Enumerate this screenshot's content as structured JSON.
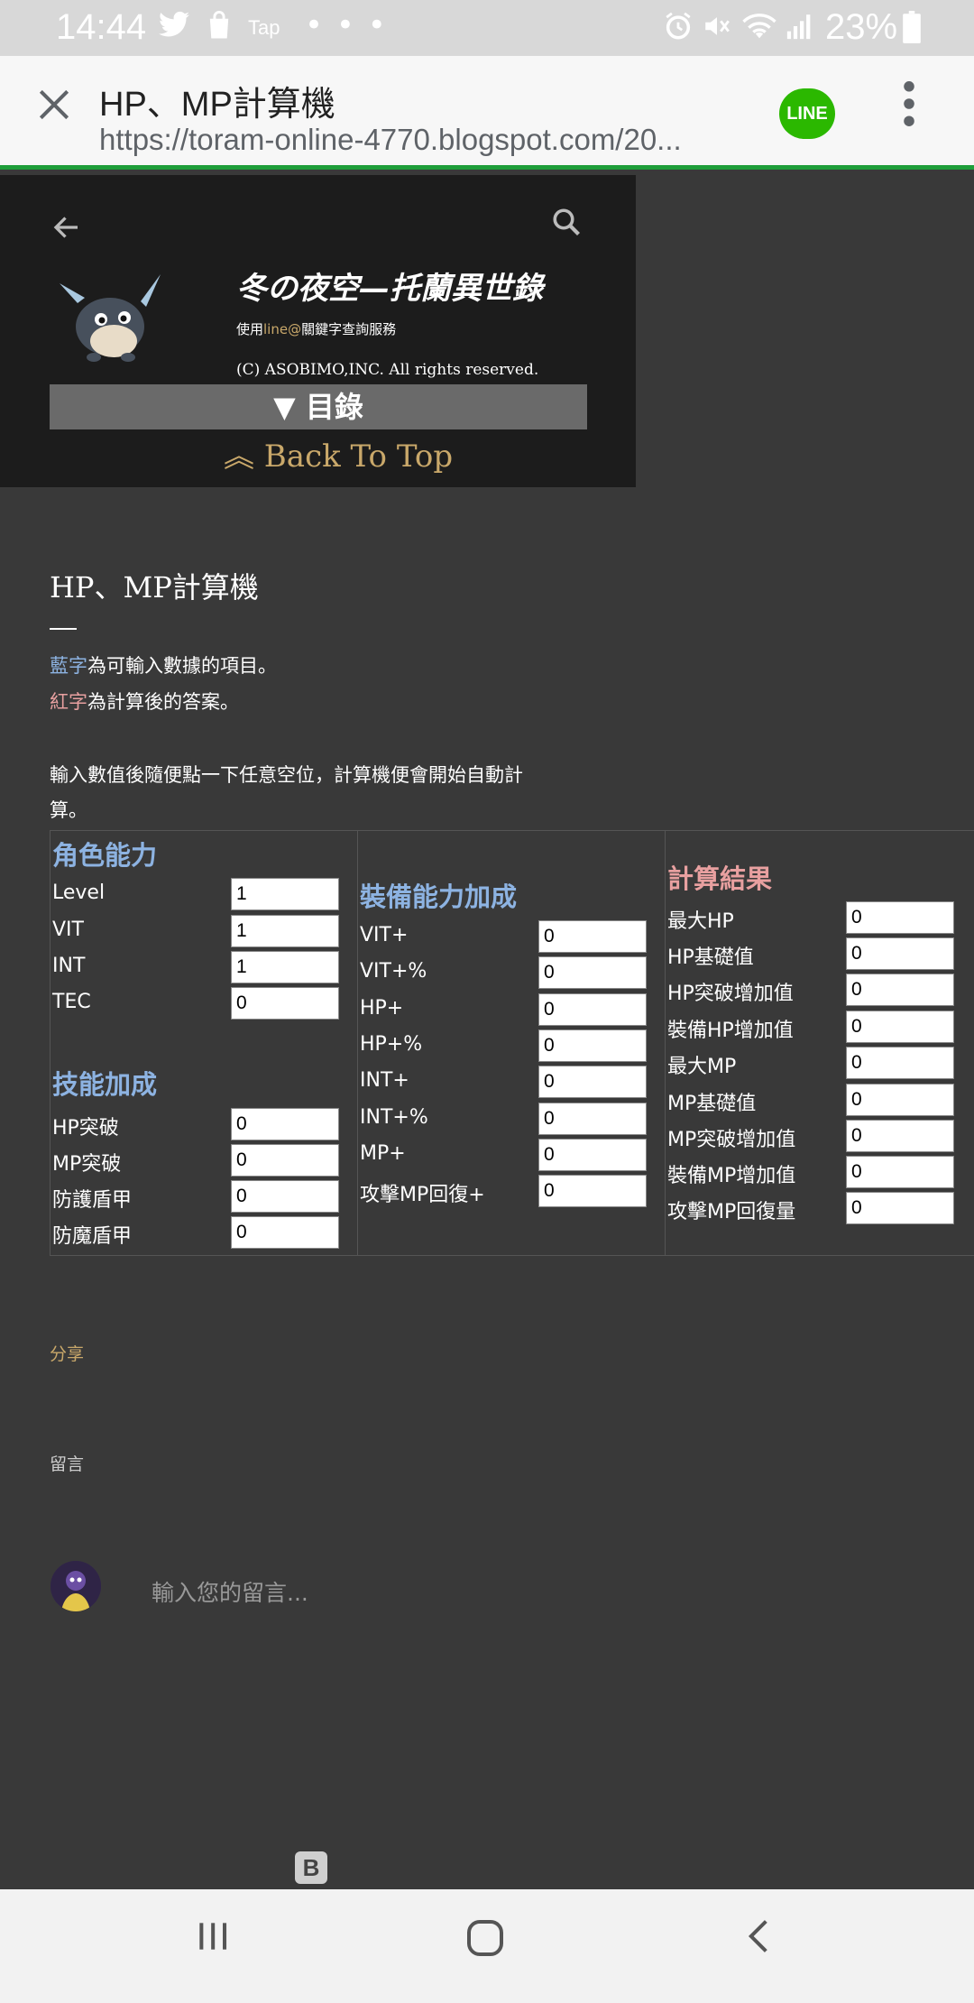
{
  "status_bar": {
    "time": "14:44",
    "app_label": "Tap",
    "battery": "23%"
  },
  "browser": {
    "title": "HP、MP計算機",
    "url": "https://toram-online-4770.blogspot.com/20...",
    "line_label": "LINE"
  },
  "blog_header": {
    "title": "冬の夜空—托蘭異世錄",
    "line_prefix": "使用",
    "line_highlight": "line@",
    "line_suffix": "關鍵字查詢服務",
    "copyright": "(C) ASOBIMO,INC. All rights reserved.",
    "toc_label": "▼ 目錄",
    "back_to_top": "︽ Back To Top"
  },
  "post": {
    "title": "HP、MP計算機",
    "blue_word": "藍字",
    "blue_rest": "為可輸入數據的項目。",
    "red_word": "紅字",
    "red_rest": "為計算後的答案。",
    "instruction_line1": "輸入數值後隨便點一下任意空位，計算機便會開始自動計",
    "instruction_line2": "算。"
  },
  "calculator": {
    "character": {
      "heading": "角色能力",
      "rows": [
        {
          "label": "Level",
          "value": "1"
        },
        {
          "label": "VIT",
          "value": "1"
        },
        {
          "label": "INT",
          "value": "1"
        },
        {
          "label": "TEC",
          "value": "0"
        }
      ]
    },
    "skills": {
      "heading": "技能加成",
      "rows": [
        {
          "label": "HP突破",
          "value": "0"
        },
        {
          "label": "MP突破",
          "value": "0"
        },
        {
          "label": "防護盾甲",
          "value": "0"
        },
        {
          "label": "防魔盾甲",
          "value": "0"
        }
      ]
    },
    "equipment": {
      "heading": "裝備能力加成",
      "rows": [
        {
          "label": "VIT+",
          "value": "0"
        },
        {
          "label": "VIT+%",
          "value": "0"
        },
        {
          "label": "HP+",
          "value": "0"
        },
        {
          "label": "HP+%",
          "value": "0"
        },
        {
          "label": "INT+",
          "value": "0"
        },
        {
          "label": "INT+%",
          "value": "0"
        },
        {
          "label": "MP+",
          "value": "0"
        },
        {
          "label": "攻擊MP回復+",
          "value": "0"
        }
      ]
    },
    "results": {
      "heading": "計算結果",
      "rows": [
        {
          "label": "最大HP",
          "value": "0"
        },
        {
          "label": "HP基礎值",
          "value": "0"
        },
        {
          "label": "HP突破增加值",
          "value": "0"
        },
        {
          "label": "裝備HP增加值",
          "value": "0"
        },
        {
          "label": "最大MP",
          "value": "0"
        },
        {
          "label": "MP基礎值",
          "value": "0"
        },
        {
          "label": "MP突破增加值",
          "value": "0"
        },
        {
          "label": "裝備MP增加值",
          "value": "0"
        },
        {
          "label": "攻擊MP回復量",
          "value": "0"
        }
      ]
    }
  },
  "footer": {
    "share": "分享",
    "comments_label": "留言",
    "comment_placeholder": "輸入您的留言...",
    "blogger_mark": "B"
  },
  "colors": {
    "page_bg": "#393939",
    "header_bg": "#1c1c1c",
    "input_blue": "#8db3e2",
    "result_red": "#e8a0a0",
    "accent_gold": "#c9a86a",
    "progress_green": "#1e9e3a"
  },
  "icons": [
    "twitter-icon",
    "shopping-bag-icon",
    "alarm-icon",
    "mute-icon",
    "wifi-icon",
    "signal-icon",
    "battery-icon",
    "close-icon",
    "more-vert-icon",
    "arrow-back-icon",
    "search-icon",
    "recents-icon",
    "home-icon",
    "back-icon"
  ]
}
